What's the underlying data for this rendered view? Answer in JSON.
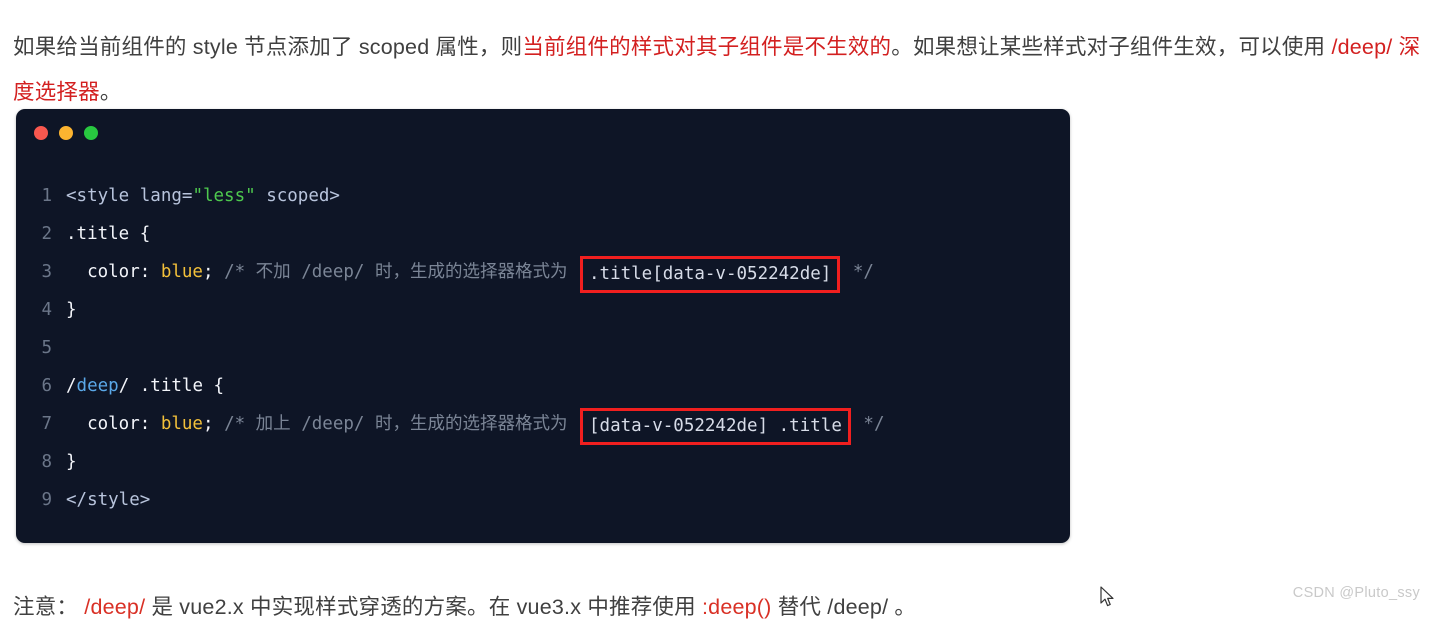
{
  "page": {
    "background": "#ffffff",
    "accent_red": "#d32020",
    "code_bg": "#0e1526"
  },
  "intro": {
    "seg1": "如果给当前组件的 style 节点添加了 scoped 属性，则",
    "seg2_red": "当前组件的样式对其子组件是不生效的",
    "seg3": "。如果想让某些样式对子组件生效，可以使用 ",
    "seg4_red": "/deep/ 深度选择器",
    "seg5": "。"
  },
  "code_window": {
    "controls": [
      {
        "name": "close",
        "color": "#f9584f"
      },
      {
        "name": "minimize",
        "color": "#fcb430"
      },
      {
        "name": "maximize",
        "color": "#28c840"
      }
    ],
    "language": "less",
    "lines": [
      {
        "number": "1",
        "parts": [
          {
            "type": "tag",
            "text": "<style lang="
          },
          {
            "type": "string",
            "text": "\"less\""
          },
          {
            "type": "tag",
            "text": " scoped>"
          }
        ]
      },
      {
        "number": "2",
        "parts": [
          {
            "type": "plain",
            "text": ".title {"
          }
        ]
      },
      {
        "number": "3",
        "parts": [
          {
            "type": "plain",
            "text": "  color: "
          },
          {
            "type": "value",
            "text": "blue"
          },
          {
            "type": "plain",
            "text": "; "
          },
          {
            "type": "comment",
            "text": "/* 不加 /deep/ 时，生成的选择器格式为 "
          },
          {
            "type": "boxed",
            "text": ".title[data-v-052242de]"
          },
          {
            "type": "comment",
            "text": " */"
          }
        ]
      },
      {
        "number": "4",
        "parts": [
          {
            "type": "plain",
            "text": "}"
          }
        ]
      },
      {
        "number": "5",
        "parts": []
      },
      {
        "number": "6",
        "parts": [
          {
            "type": "plain",
            "text": "/"
          },
          {
            "type": "deep",
            "text": "deep"
          },
          {
            "type": "plain",
            "text": "/ .title {"
          }
        ]
      },
      {
        "number": "7",
        "parts": [
          {
            "type": "plain",
            "text": "  color: "
          },
          {
            "type": "value",
            "text": "blue"
          },
          {
            "type": "plain",
            "text": "; "
          },
          {
            "type": "comment",
            "text": "/* 加上 /deep/ 时，生成的选择器格式为 "
          },
          {
            "type": "boxed",
            "text": "[data-v-052242de] .title"
          },
          {
            "type": "comment",
            "text": " */"
          }
        ]
      },
      {
        "number": "8",
        "parts": [
          {
            "type": "plain",
            "text": "}"
          }
        ]
      },
      {
        "number": "9",
        "parts": [
          {
            "type": "tag",
            "text": "</style>"
          }
        ]
      }
    ]
  },
  "note": {
    "seg1": "注意：",
    "seg2_red": " /deep/ ",
    "seg3": "是 vue2.x 中实现样式穿透的方案。在 vue3.x 中推荐使用 ",
    "seg4_red": ":deep()",
    "seg5": " 替代 /deep/ 。"
  },
  "watermark": {
    "text": "CSDN @Pluto_ssy"
  }
}
